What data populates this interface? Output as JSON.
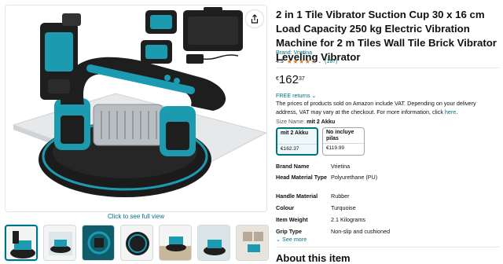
{
  "gallery": {
    "click_to_see": "Click to see full view",
    "thumbnails": [
      {
        "name": "thumb-tool-front",
        "selected": true
      },
      {
        "name": "thumb-dimensions"
      },
      {
        "name": "thumb-features"
      },
      {
        "name": "thumb-suction-cup"
      },
      {
        "name": "thumb-tile-use"
      },
      {
        "name": "thumb-vibration"
      },
      {
        "name": "thumb-wall-use"
      }
    ]
  },
  "product": {
    "title": "2 in 1 Tile Vibrator Suction Cup 30 x 16 cm Load Capacity 250 kg Electric Vibration Machine for 2 m Tiles Wall Tile Brick Vibrator Leveling Vibrator",
    "brand_link": "Brand: Vrietina",
    "rating": "4.3",
    "stars": "★★★★☆",
    "rating_count": "(187)",
    "price": {
      "symbol": "€",
      "whole": "162",
      "fraction": "37"
    },
    "free_returns": "FREE returns",
    "chevron": "⌄",
    "vat_text": "The prices of products sold on Amazon include VAT. Depending on your delivery address, VAT may vary at the checkout. For more information, click",
    "vat_link": "here",
    "vat_end": ".",
    "size_label": "Size Name:",
    "size_selected": "mit 2 Akku",
    "size_options": [
      {
        "name": "mit 2 Akku",
        "price": "€162.37",
        "selected": true
      },
      {
        "name": "No incluye pilas",
        "price": "€119.99",
        "selected": false
      }
    ],
    "specs": [
      {
        "key": "Brand Name",
        "value": "Vrietina"
      },
      {
        "key": "Head Material Type",
        "value": "Polyurethane (PU)"
      },
      {
        "key": "Handle Material",
        "value": "Rubber"
      },
      {
        "key": "Colour",
        "value": "Turquoise"
      },
      {
        "key": "Item Weight",
        "value": "2.1 Kilograms"
      },
      {
        "key": "Grip Type",
        "value": "Non-slip and cushioned"
      }
    ],
    "see_more": "See more",
    "about_heading": "About this item"
  },
  "colors": {
    "accent_link": "#007185",
    "star": "#de7921",
    "product_body": "#1c9bb0",
    "product_black": "#1e1e1e"
  }
}
